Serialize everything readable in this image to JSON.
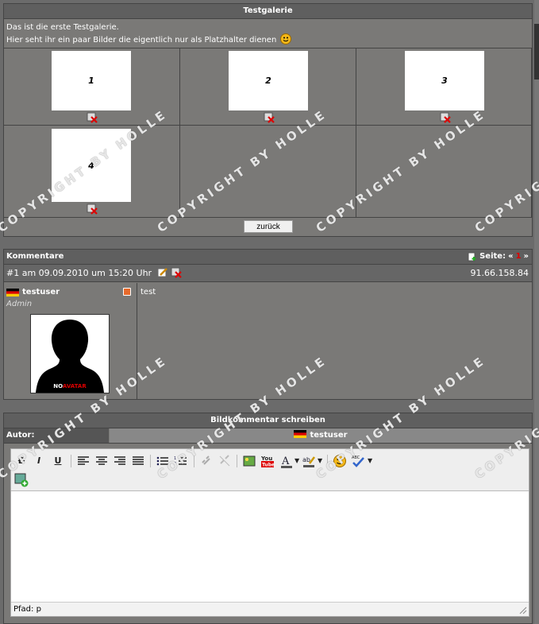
{
  "gallery": {
    "title": "Testgalerie",
    "desc_line1": "Das ist die erste Testgalerie.",
    "desc_line2": "Hier seht ihr ein paar Bilder die eigentlich nur als Platzhalter dienen",
    "thumbs": [
      "1",
      "2",
      "3",
      "4"
    ],
    "back_label": "zurück"
  },
  "comments": {
    "title": "Kommentare",
    "page_label": "Seite:",
    "prev": "«",
    "page_current": "1",
    "next": "»",
    "entry": {
      "header": "#1 am 09.09.2010 um 15:20 Uhr",
      "ip": "91.66.158.84",
      "username": "testuser",
      "role": "Admin",
      "text": "test",
      "avatar_no": "NO",
      "avatar_avatar": "AVATAR"
    }
  },
  "write": {
    "title": "Bildkommentar schreiben",
    "author_label": "Autor:",
    "author_value": "testuser",
    "path_label": "Pfad: p",
    "toolbar": {
      "bold": "B",
      "italic": "I",
      "underline": "U"
    }
  },
  "watermark": "COPYRIGHT BY HOLLE",
  "colors": {
    "accent_red": "#dd0000",
    "panel": "#7a7977",
    "bar": "#5f5f5f"
  }
}
